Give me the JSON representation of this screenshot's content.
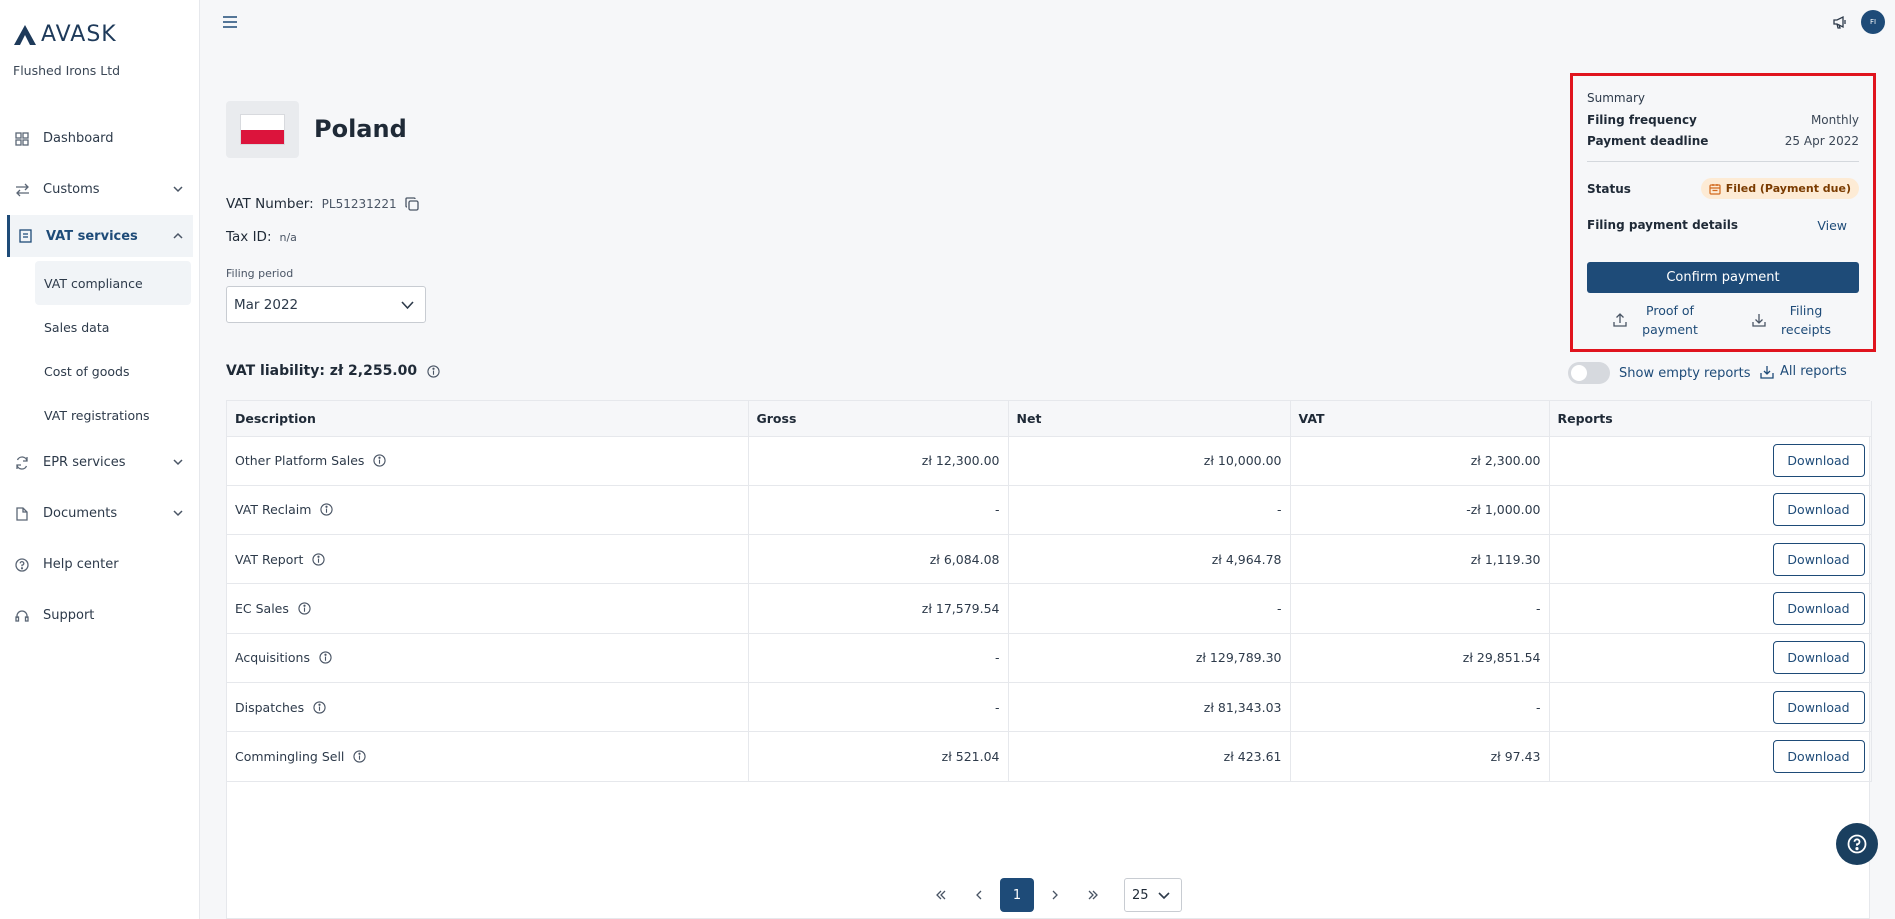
{
  "brand": {
    "name": "AVASK",
    "company": "Flushed Irons Ltd"
  },
  "nav": {
    "dashboard": "Dashboard",
    "customs": "Customs",
    "vat_services": "VAT services",
    "sub": {
      "vat_compliance": "VAT compliance",
      "sales_data": "Sales data",
      "cost_of_goods": "Cost of goods",
      "vat_registrations": "VAT registrations"
    },
    "epr_services": "EPR services",
    "documents": "Documents",
    "help_center": "Help center",
    "support": "Support"
  },
  "user": {
    "initials": "FI"
  },
  "country": {
    "name": "Poland",
    "vat_number_label": "VAT Number:",
    "vat_number": "PL51231221",
    "tax_id_label": "Tax ID:",
    "tax_id": "n/a",
    "filing_period_label": "Filing period",
    "filing_period": "Mar 2022"
  },
  "liability": {
    "label": "VAT liability: zł 2,255.00"
  },
  "summary": {
    "title": "Summary",
    "filing_frequency_label": "Filing frequency",
    "filing_frequency": "Monthly",
    "payment_deadline_label": "Payment deadline",
    "payment_deadline": "25 Apr 2022",
    "status_label": "Status",
    "status": "Filed (Payment due)",
    "payment_details_label": "Filing payment details",
    "view": "View",
    "confirm": "Confirm payment",
    "proof_line1": "Proof of",
    "proof_line2": "payment",
    "receipts_line1": "Filing",
    "receipts_line2": "receipts",
    "highlight_color": "#e0141e"
  },
  "table_actions": {
    "show_empty": "Show empty reports",
    "all_reports": "All reports"
  },
  "table": {
    "headers": [
      "Description",
      "Gross",
      "Net",
      "VAT",
      "Reports"
    ],
    "download": "Download",
    "rows": [
      {
        "desc": "Other Platform Sales",
        "gross": "zł 12,300.00",
        "net": "zł 10,000.00",
        "vat": "zł 2,300.00"
      },
      {
        "desc": "VAT Reclaim",
        "gross": "-",
        "net": "-",
        "vat": "-zł 1,000.00"
      },
      {
        "desc": "VAT Report",
        "gross": "zł 6,084.08",
        "net": "zł 4,964.78",
        "vat": "zł 1,119.30"
      },
      {
        "desc": "EC Sales",
        "gross": "zł 17,579.54",
        "net": "-",
        "vat": "-"
      },
      {
        "desc": "Acquisitions",
        "gross": "-",
        "net": "zł 129,789.30",
        "vat": "zł 29,851.54"
      },
      {
        "desc": "Dispatches",
        "gross": "-",
        "net": "zł 81,343.03",
        "vat": "-"
      },
      {
        "desc": "Commingling Sell",
        "gross": "zł 521.04",
        "net": "zł 423.61",
        "vat": "zł 97.43"
      }
    ]
  },
  "pagination": {
    "current": "1",
    "per_page": "25"
  },
  "colors": {
    "primary": "#1e4b78",
    "badge_bg": "#fdebd5"
  }
}
